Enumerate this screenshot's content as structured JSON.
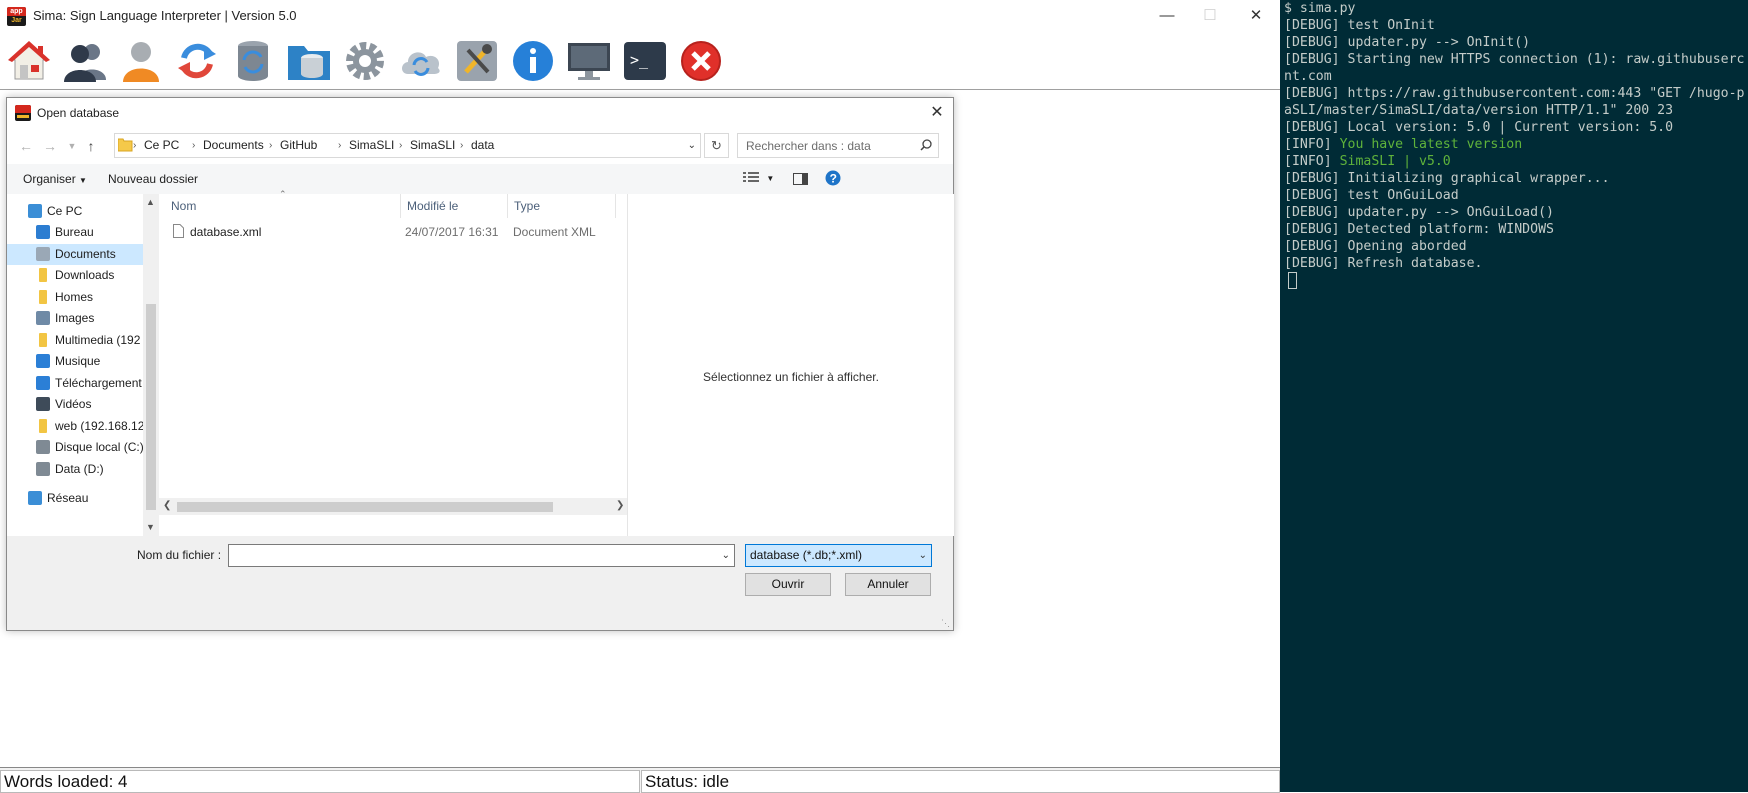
{
  "app": {
    "title": "Sima: Sign Language Interpreter | Version 5.0",
    "icon_top": "app",
    "icon_bottom": "Jar",
    "toolbar": [
      {
        "name": "home-icon"
      },
      {
        "name": "users-icon"
      },
      {
        "name": "user-icon"
      },
      {
        "name": "sync-icon"
      },
      {
        "name": "database-sync-icon"
      },
      {
        "name": "database-folder-icon"
      },
      {
        "name": "gear-icon"
      },
      {
        "name": "cloud-sync-icon"
      },
      {
        "name": "tools-icon"
      },
      {
        "name": "info-icon"
      },
      {
        "name": "monitor-icon"
      },
      {
        "name": "terminal-icon",
        "glyph": ">_"
      },
      {
        "name": "close-circle-icon"
      }
    ],
    "status": {
      "words": "Words loaded: 4",
      "state": "Status: idle"
    }
  },
  "dialog": {
    "title": "Open database",
    "breadcrumb": [
      "Ce PC",
      "Documents",
      "GitHub",
      "SimaSLI",
      "SimaSLI",
      "data"
    ],
    "search_placeholder": "Rechercher dans : data",
    "organize_label": "Organiser",
    "new_folder_label": "Nouveau dossier",
    "nav_items": [
      {
        "label": "Ce PC",
        "icon": "computer-icon",
        "indent": 1
      },
      {
        "label": "Bureau",
        "icon": "desktop-icon",
        "indent": 2
      },
      {
        "label": "Documents",
        "icon": "documents-icon",
        "indent": 2,
        "selected": true
      },
      {
        "label": "Downloads",
        "icon": "folder-icon",
        "indent": 2
      },
      {
        "label": "Homes",
        "icon": "folder-icon",
        "indent": 2
      },
      {
        "label": "Images",
        "icon": "images-icon",
        "indent": 2
      },
      {
        "label": "Multimedia (192",
        "icon": "folder-icon",
        "indent": 2
      },
      {
        "label": "Musique",
        "icon": "music-icon",
        "indent": 2
      },
      {
        "label": "Téléchargement",
        "icon": "download-icon",
        "indent": 2
      },
      {
        "label": "Vidéos",
        "icon": "video-icon",
        "indent": 2
      },
      {
        "label": "web (192.168.12:",
        "icon": "folder-icon",
        "indent": 2
      },
      {
        "label": "Disque local (C:)",
        "icon": "drive-icon",
        "indent": 2
      },
      {
        "label": "Data (D:)",
        "icon": "drive-icon",
        "indent": 2
      },
      {
        "label": "Réseau",
        "icon": "network-icon",
        "indent": 1
      }
    ],
    "columns": {
      "name": "Nom",
      "modified": "Modifié le",
      "type": "Type"
    },
    "files": [
      {
        "name": "database.xml",
        "modified": "24/07/2017 16:31",
        "type": "Document XML"
      }
    ],
    "preview_text": "Sélectionnez un fichier à afficher.",
    "filename_label": "Nom du fichier :",
    "filename_value": "",
    "filter_value": "database (*.db;*.xml)",
    "open_label": "Ouvrir",
    "cancel_label": "Annuler"
  },
  "terminal": {
    "lines": [
      {
        "text": "$ sima.py"
      },
      {
        "text": "[DEBUG] test OnInit"
      },
      {
        "text": "[DEBUG] updater.py --> OnInit()"
      },
      {
        "text": "[DEBUG] Starting new HTTPS connection (1): raw.githubuserc"
      },
      {
        "text": "nt.com"
      },
      {
        "text": "[DEBUG] https://raw.githubusercontent.com:443 \"GET /hugo-p"
      },
      {
        "text": "aSLI/master/SimaSLI/data/version HTTP/1.1\" 200 23"
      },
      {
        "text": "[DEBUG] Local version: 5.0 | Current version: 5.0"
      },
      {
        "text": "[INFO] ",
        "green": "You have latest version"
      },
      {
        "text": "[INFO] ",
        "green": "SimaSLI | v5.0"
      },
      {
        "text": "[DEBUG] Initializing graphical wrapper..."
      },
      {
        "text": "[DEBUG] test OnGuiLoad"
      },
      {
        "text": "[DEBUG] updater.py --> OnGuiLoad()"
      },
      {
        "text": "[DEBUG] Detected platform: WINDOWS"
      },
      {
        "text": "[DEBUG] Opening aborded"
      },
      {
        "text": "[DEBUG] Refresh database."
      }
    ],
    "colors": {
      "background": "#002b36",
      "text": "#c4ccc9",
      "green": "#5fb33b"
    }
  }
}
